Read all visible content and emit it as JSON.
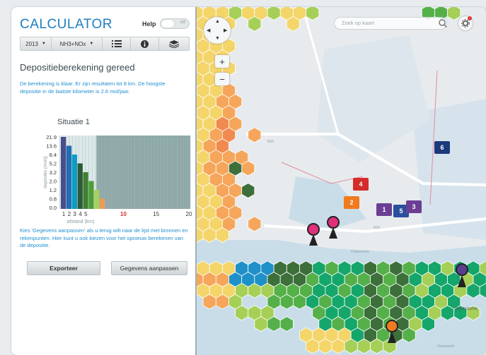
{
  "app": {
    "title": "CALCULATOR",
    "help_label": "Help",
    "help_toggle": "uit"
  },
  "toolbar": {
    "year": "2013",
    "substance": "NH3+NOx",
    "list_icon": "list-icon",
    "info_icon": "info-icon",
    "layers_icon": "layers-icon"
  },
  "result": {
    "heading": "Depositieberekening gereed",
    "text": "De berekening is klaar. Er zijn resultaten tot 8 km. De hoogste depositie in de laatste kilometer is 2.6 mol/jaar."
  },
  "chart_data": {
    "type": "bar",
    "title": "Situatie 1",
    "ylabel": "depositie (mol/j)",
    "xlabel": "afstand (km)",
    "yticks": [
      "21.9",
      "13.6",
      "8.4",
      "5.2",
      "3.2",
      "2.0",
      "1.2",
      "0.8",
      "0.0"
    ],
    "xticks": [
      "1",
      "2",
      "3",
      "4",
      "5",
      "10",
      "15",
      "20"
    ],
    "highlight_xtick": "10",
    "categories": [
      "1",
      "2",
      "3",
      "4",
      "5",
      "6",
      "7",
      "8"
    ],
    "values": [
      21.9,
      13.6,
      8.4,
      5.2,
      3.2,
      2.0,
      1.2,
      0.8
    ],
    "colors": [
      "#4b4c8c",
      "#1f6fb2",
      "#0d9cc4",
      "#2d5a36",
      "#3f7f32",
      "#4f9c3a",
      "#a8d060",
      "#f09a5a"
    ]
  },
  "note": "Kies 'Gegevens aanpassen' als u terug wilt naar de lijst met bronnen en rekenpunten. Hier kunt u ook kiezen voor het opnieuw berekenen van de depositie.",
  "buttons": {
    "export": "Exporteer",
    "adjust": "Gegevens aanpassen"
  },
  "map": {
    "search_placeholder": "Zoek op kaart",
    "zoom_in": "+",
    "zoom_out": "−",
    "labels": {
      "road": "N15",
      "road2": "N15",
      "west": "Westvoorne",
      "oostvoorne": "Oostvoorne",
      "oostbosch": "Overbosch"
    },
    "markers": [
      {
        "label": "1",
        "color": "#6a3f93"
      },
      {
        "label": "2",
        "color": "#f07a1e"
      },
      {
        "label": "3",
        "color": "#6a3f93"
      },
      {
        "label": "4",
        "color": "#d52b2b"
      },
      {
        "label": "5",
        "color": "#2a4f9c"
      },
      {
        "label": "6",
        "color": "#1c3a7a"
      }
    ],
    "pin_colors": {
      "pink": "#e0307a",
      "orange": "#f07a1e",
      "purple": "#5a3e8e"
    },
    "hex_colors": {
      "red_orange": "#f08a4e",
      "orange": "#f5a65a",
      "yellow": "#f4d56a",
      "light_green": "#a6cf57",
      "green": "#55b04a",
      "dark_green": "#3c6f3a",
      "teal": "#15a66b",
      "blue": "#1f90c8"
    }
  }
}
